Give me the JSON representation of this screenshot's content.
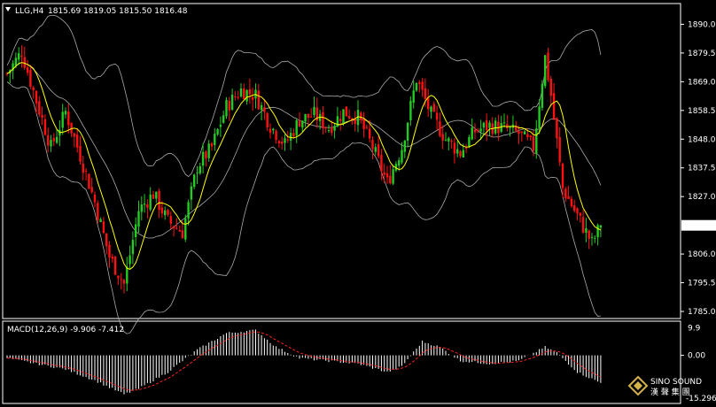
{
  "header": {
    "symbol": "LLG,H4",
    "ohlc": "1815.69 1819.05 1815.50 1816.48"
  },
  "macd": {
    "label": "MACD(12,26,9) -9.906 -7.412",
    "ticks": [
      "9.9",
      "0.00",
      "-15.296"
    ]
  },
  "logo": {
    "brand": "SINO SOUND",
    "sub": "漢 聲 集 團"
  },
  "colors": {
    "background": "#000000",
    "bull": "#22cc22",
    "bear": "#ff1111",
    "ma": "#ffff00",
    "band": "#aaaaaa",
    "macd_hist": "#ffffff",
    "macd_signal": "#ff2222",
    "price_box": "#ffffff"
  },
  "chart_data": {
    "type": "candlestick",
    "price_axis": {
      "min": 1785.0,
      "max": 1895.0,
      "ticks": [
        "1890.00",
        "1879.50",
        "1869.00",
        "1858.50",
        "1848.00",
        "1837.50",
        "1827.00",
        "1816.48",
        "1806.00",
        "1795.50",
        "1785.00"
      ],
      "current": "1816.48"
    },
    "anchors": [
      [
        0,
        1872
      ],
      [
        5,
        1880
      ],
      [
        10,
        1862
      ],
      [
        15,
        1845
      ],
      [
        20,
        1858
      ],
      [
        25,
        1842
      ],
      [
        30,
        1825
      ],
      [
        35,
        1805
      ],
      [
        40,
        1795
      ],
      [
        45,
        1822
      ],
      [
        50,
        1828
      ],
      [
        55,
        1818
      ],
      [
        60,
        1814
      ],
      [
        65,
        1838
      ],
      [
        70,
        1845
      ],
      [
        75,
        1860
      ],
      [
        80,
        1866
      ],
      [
        85,
        1864
      ],
      [
        90,
        1853
      ],
      [
        95,
        1846
      ],
      [
        100,
        1855
      ],
      [
        105,
        1857
      ],
      [
        110,
        1852
      ],
      [
        115,
        1858
      ],
      [
        120,
        1856
      ],
      [
        125,
        1845
      ],
      [
        130,
        1832
      ],
      [
        135,
        1845
      ],
      [
        140,
        1870
      ],
      [
        145,
        1857
      ],
      [
        150,
        1848
      ],
      [
        155,
        1843
      ],
      [
        160,
        1851
      ],
      [
        165,
        1853
      ],
      [
        170,
        1852
      ],
      [
        175,
        1850
      ],
      [
        180,
        1845
      ],
      [
        184,
        1878
      ],
      [
        186,
        1864
      ],
      [
        190,
        1830
      ],
      [
        195,
        1820
      ],
      [
        200,
        1810
      ],
      [
        203,
        1816.48
      ]
    ],
    "macd_anchors": [
      [
        0,
        -1
      ],
      [
        10,
        -3
      ],
      [
        20,
        -5
      ],
      [
        30,
        -9
      ],
      [
        40,
        -14
      ],
      [
        45,
        -12
      ],
      [
        55,
        -6
      ],
      [
        65,
        2
      ],
      [
        75,
        8
      ],
      [
        85,
        9
      ],
      [
        92,
        3
      ],
      [
        100,
        -1
      ],
      [
        110,
        -2
      ],
      [
        120,
        -3
      ],
      [
        130,
        -6
      ],
      [
        135,
        -4
      ],
      [
        142,
        5
      ],
      [
        148,
        3
      ],
      [
        155,
        -2
      ],
      [
        165,
        -3
      ],
      [
        175,
        -2
      ],
      [
        184,
        3
      ],
      [
        188,
        1
      ],
      [
        195,
        -6
      ],
      [
        203,
        -9.906
      ]
    ]
  }
}
